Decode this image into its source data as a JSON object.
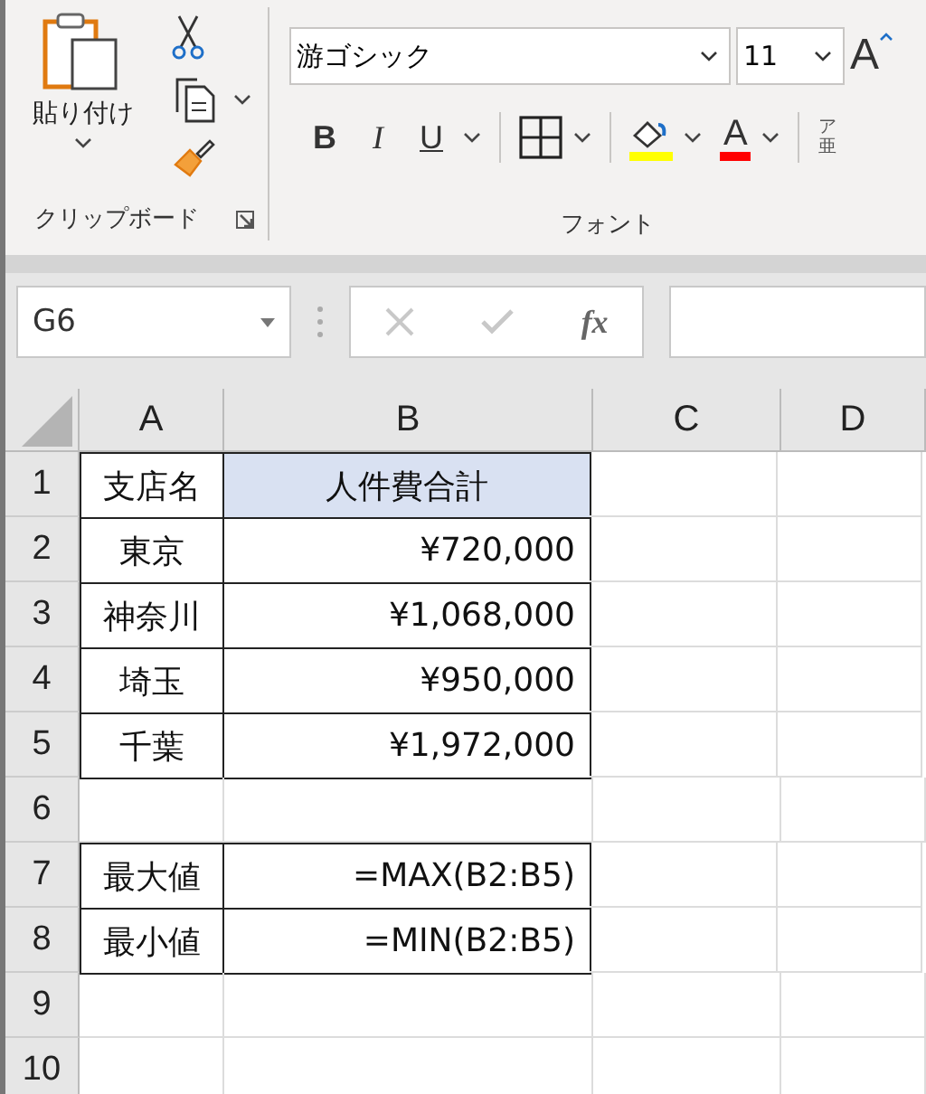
{
  "ribbon": {
    "clipboard": {
      "paste_label": "貼り付け",
      "group_label": "クリップボード"
    },
    "font": {
      "font_name": "游ゴシック",
      "font_size": "11",
      "grow_font": "A",
      "bold": "B",
      "italic": "I",
      "underline": "U",
      "font_color": "A",
      "phonetic_top": "ア",
      "phonetic_base": "亜",
      "group_label": "フォント"
    }
  },
  "formula_bar": {
    "name_box": "G6",
    "fx": "fx"
  },
  "columns": [
    "A",
    "B",
    "C",
    "D"
  ],
  "rows": [
    {
      "number": "1",
      "kind": "header",
      "cells": [
        {
          "text": "支店名",
          "filled": false,
          "border": true
        },
        {
          "text": "人件費合計",
          "filled": true,
          "border": true
        }
      ]
    },
    {
      "number": "2",
      "cells": [
        {
          "text": "東京",
          "filled": false,
          "border": true
        },
        {
          "text": "¥720,000",
          "filled": false,
          "border": true
        }
      ]
    },
    {
      "number": "3",
      "cells": [
        {
          "text": "神奈川",
          "filled": false,
          "border": true
        },
        {
          "text": "¥1,068,000",
          "filled": false,
          "border": true
        }
      ]
    },
    {
      "number": "4",
      "cells": [
        {
          "text": "埼玉",
          "filled": false,
          "border": true
        },
        {
          "text": "¥950,000",
          "filled": false,
          "border": true
        }
      ]
    },
    {
      "number": "5",
      "cells": [
        {
          "text": "千葉",
          "filled": false,
          "border": true
        },
        {
          "text": "¥1,972,000",
          "filled": false,
          "border": true
        }
      ]
    },
    {
      "number": "6"
    },
    {
      "number": "7",
      "cells": [
        {
          "text": "最大値",
          "filled": false,
          "border": true
        },
        {
          "text": "=MAX(B2:B5)",
          "filled": false,
          "border": true
        }
      ]
    },
    {
      "number": "8",
      "cells": [
        {
          "text": "最小値",
          "filled": false,
          "border": true
        },
        {
          "text": "=MIN(B2:B5)",
          "filled": false,
          "border": true
        }
      ]
    },
    {
      "number": "9"
    },
    {
      "number": "10"
    }
  ]
}
